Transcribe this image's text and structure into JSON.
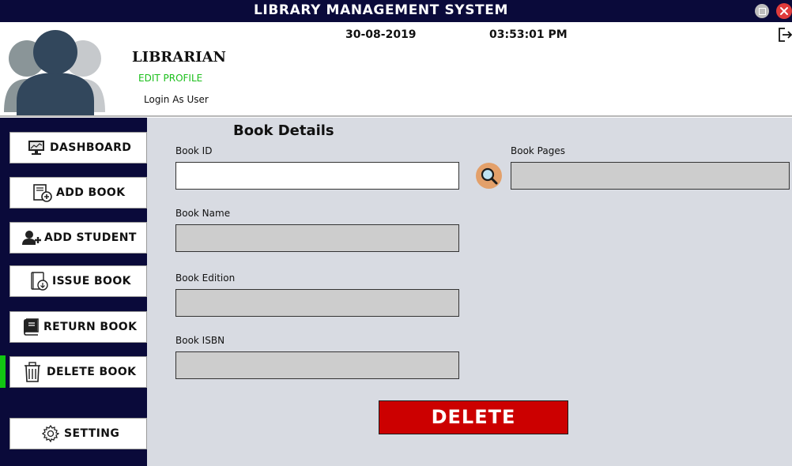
{
  "window": {
    "title": "LIBRARY MANAGEMENT SYSTEM",
    "maximize_icon": "maximize-icon",
    "close_icon": "close-icon",
    "close_color": "#e03b3b"
  },
  "header": {
    "role": "LIBRARIAN",
    "edit_profile": "EDIT PROFILE",
    "login_as_user": "Login As User",
    "date": "30-08-2019",
    "time": "03:53:01 PM",
    "avatar_icon": "user-group-icon",
    "logout_icon": "logout-icon",
    "edit_profile_color": "#1bbf1b"
  },
  "sidebar": {
    "background": "#0a0a3a",
    "active_item": "DELETE BOOK",
    "active_color": "#12c612",
    "items": [
      {
        "label": "DASHBOARD",
        "icon": "dashboard-monitor-icon"
      },
      {
        "label": "ADD BOOK",
        "icon": "add-book-icon"
      },
      {
        "label": "ADD STUDENT",
        "icon": "add-user-icon"
      },
      {
        "label": "ISSUE BOOK",
        "icon": "issue-book-icon"
      },
      {
        "label": "RETURN BOOK",
        "icon": "book-icon"
      },
      {
        "label": "DELETE BOOK",
        "icon": "trash-icon"
      },
      {
        "label": "SETTING",
        "icon": "gear-icon"
      }
    ]
  },
  "form": {
    "title": "Book Details",
    "book_id_label": "Book ID",
    "book_id_value": "",
    "book_name_label": "Book Name",
    "book_name_value": "",
    "book_edition_label": "Book Edition",
    "book_edition_value": "",
    "book_isbn_label": "Book ISBN",
    "book_isbn_value": "",
    "book_pages_label": "Book Pages",
    "book_pages_value": "",
    "search_icon": "search-icon",
    "delete_label": "DELETE",
    "delete_color": "#cc0000"
  }
}
